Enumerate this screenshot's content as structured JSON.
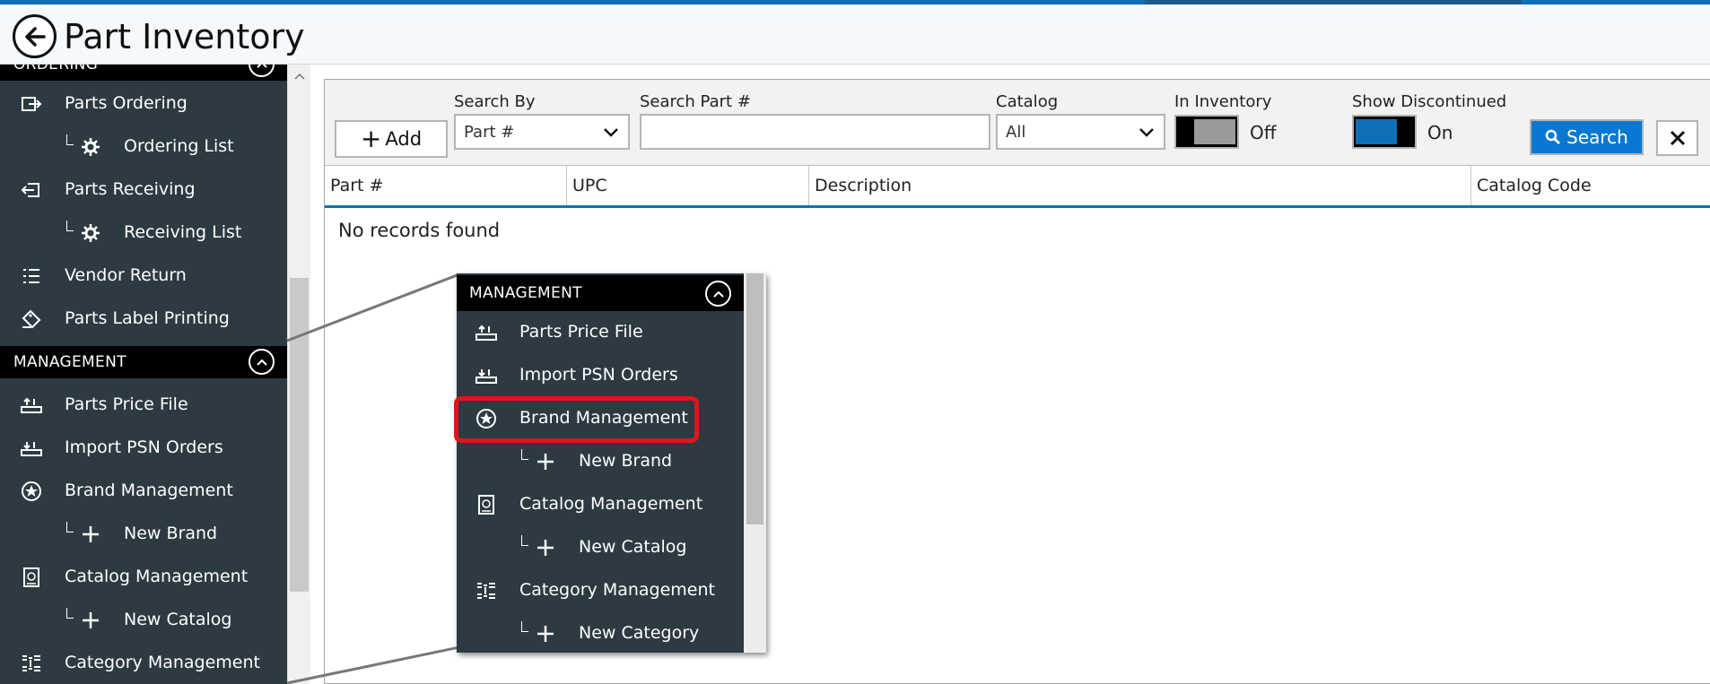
{
  "header": {
    "title": "Part Inventory"
  },
  "sidebar": {
    "partial_section": "ORDERING",
    "ordering_items": [
      {
        "label": "Parts Ordering",
        "icon": "parts-ordering-icon",
        "sub": false
      },
      {
        "label": "Ordering List",
        "icon": "gear-icon",
        "sub": true
      },
      {
        "label": "Parts Receiving",
        "icon": "parts-receiving-icon",
        "sub": false
      },
      {
        "label": "Receiving List",
        "icon": "gear-icon",
        "sub": true
      },
      {
        "label": "Vendor Return",
        "icon": "list-icon",
        "sub": false
      },
      {
        "label": "Parts Label Printing",
        "icon": "label-icon",
        "sub": false
      }
    ],
    "management_section": "MANAGEMENT",
    "management_items": [
      {
        "label": "Parts Price File",
        "icon": "price-file-icon",
        "sub": false
      },
      {
        "label": "Import PSN Orders",
        "icon": "import-icon",
        "sub": false
      },
      {
        "label": "Brand Management",
        "icon": "brand-icon",
        "sub": false
      },
      {
        "label": "New Brand",
        "icon": "plus-icon",
        "sub": true
      },
      {
        "label": "Catalog Management",
        "icon": "catalog-icon",
        "sub": false
      },
      {
        "label": "New Catalog",
        "icon": "plus-icon",
        "sub": true
      },
      {
        "label": "Category Management",
        "icon": "category-icon",
        "sub": false
      }
    ]
  },
  "toolbar": {
    "add_label": "Add",
    "search_by_label": "Search By",
    "search_by_value": "Part #",
    "search_part_label": "Search Part #",
    "search_part_value": "",
    "catalog_label": "Catalog",
    "catalog_value": "All",
    "in_inventory_label": "In Inventory",
    "in_inventory_state": "Off",
    "show_discontinued_label": "Show Discontinued",
    "show_discontinued_state": "On",
    "search_label": "Search"
  },
  "table": {
    "columns": [
      "Part #",
      "UPC",
      "Description",
      "Catalog Code"
    ],
    "empty_message": "No records found"
  },
  "callout": {
    "section": "MANAGEMENT",
    "items": [
      {
        "label": "Parts Price File",
        "sub": false
      },
      {
        "label": "Import PSN Orders",
        "sub": false
      },
      {
        "label": "Brand Management",
        "sub": false
      },
      {
        "label": "New Brand",
        "sub": true
      },
      {
        "label": "Catalog Management",
        "sub": false
      },
      {
        "label": "New Catalog",
        "sub": true
      },
      {
        "label": "Category Management",
        "sub": false
      },
      {
        "label": "New Category",
        "sub": true
      }
    ],
    "highlighted": "Brand Management"
  },
  "colors": {
    "sidebar_bg": "#2d3a41",
    "accent": "#0e6fb6",
    "search_button": "#0a78d1",
    "highlight": "#e0141c"
  }
}
